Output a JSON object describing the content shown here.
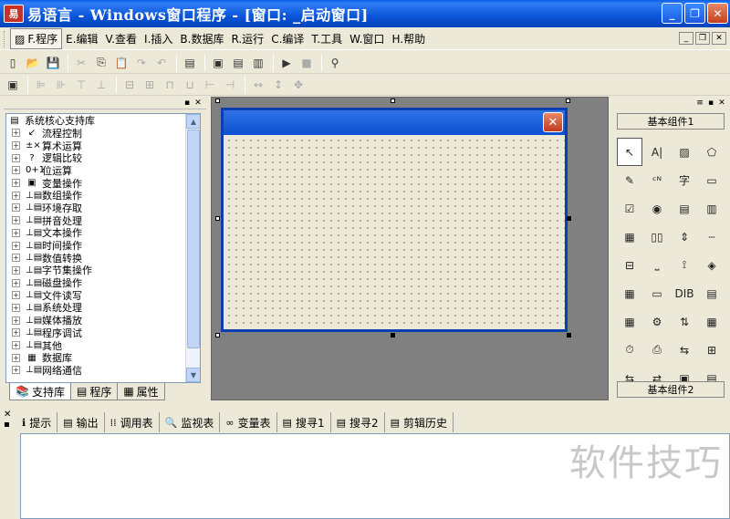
{
  "window": {
    "title": "易语言 - Windows窗口程序 - [窗口: _启动窗口]",
    "logo": "易"
  },
  "menu": [
    "F.程序",
    "E.编辑",
    "V.查看",
    "I.插入",
    "B.数据库",
    "R.运行",
    "C.编译",
    "T.工具",
    "W.窗口",
    "H.帮助"
  ],
  "support_library": {
    "root": "系统核心支持库",
    "items": [
      {
        "icon": "↙",
        "label": "流程控制"
      },
      {
        "icon": "±×",
        "label": "算术运算"
      },
      {
        "icon": "?",
        "label": "逻辑比较"
      },
      {
        "icon": "0+1",
        "label": "位运算"
      },
      {
        "icon": "▣",
        "label": "变量操作"
      },
      {
        "icon": "⊥▤",
        "label": "数组操作"
      },
      {
        "icon": "⊥▤",
        "label": "环境存取"
      },
      {
        "icon": "⊥▤",
        "label": "拼音处理"
      },
      {
        "icon": "⊥▤",
        "label": "文本操作"
      },
      {
        "icon": "⊥▤",
        "label": "时间操作"
      },
      {
        "icon": "⊥▤",
        "label": "数值转换"
      },
      {
        "icon": "⊥▤",
        "label": "字节集操作"
      },
      {
        "icon": "⊥▤",
        "label": "磁盘操作"
      },
      {
        "icon": "⊥▤",
        "label": "文件读写"
      },
      {
        "icon": "⊥▤",
        "label": "系统处理"
      },
      {
        "icon": "⊥▤",
        "label": "媒体播放"
      },
      {
        "icon": "⊥▤",
        "label": "程序调试"
      },
      {
        "icon": "⊥▤",
        "label": "其他"
      },
      {
        "icon": "▦",
        "label": "数据库"
      },
      {
        "icon": "⊥▤",
        "label": "网络通信"
      }
    ]
  },
  "left_tabs": [
    "支持库",
    "程序",
    "属性"
  ],
  "components": {
    "group1": "基本组件1",
    "group2": "基本组件2",
    "icons": [
      "↖",
      "A|",
      "▨",
      "⬠",
      "✎",
      "ᶜᴺ",
      "字",
      "▭",
      "☑",
      "◉",
      "▤",
      "▥",
      "▦",
      "▯▯",
      "⇕",
      "┄",
      "⊟",
      "⎵",
      "⟟",
      "◈",
      "▦",
      "▭",
      "DIB",
      "▤",
      "▦",
      "⚙",
      "⇅",
      "▦",
      "⏱",
      "⎙",
      "⇆",
      "⊞",
      "⇆",
      "⇄",
      "▣",
      "▤"
    ]
  },
  "output_tabs": [
    {
      "icon": "ℹ",
      "label": "提示"
    },
    {
      "icon": "▤",
      "label": "输出"
    },
    {
      "icon": "⁞⁞",
      "label": "调用表"
    },
    {
      "icon": "🔍",
      "label": "监视表"
    },
    {
      "icon": "∞",
      "label": "变量表"
    },
    {
      "icon": "▤",
      "label": "搜寻1"
    },
    {
      "icon": "▤",
      "label": "搜寻2"
    },
    {
      "icon": "▤",
      "label": "剪辑历史"
    }
  ],
  "watermark": "软件技巧"
}
